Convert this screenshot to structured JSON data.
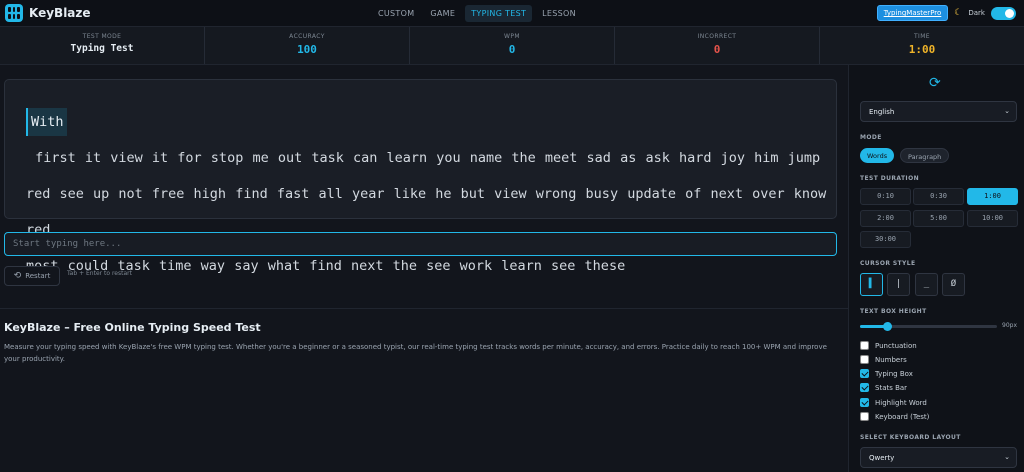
{
  "app": {
    "name": "KeyBlaze"
  },
  "nav": {
    "tabs": [
      {
        "label": "CUSTOM",
        "active": false
      },
      {
        "label": "GAME",
        "active": false
      },
      {
        "label": "TYPING TEST",
        "active": true
      },
      {
        "label": "LESSON",
        "active": false
      }
    ]
  },
  "header_right": {
    "pro_label": "TypingMasterPro",
    "dark_label": "Dark",
    "dark_enabled": true
  },
  "stats": [
    {
      "label": "TEST MODE",
      "value": "Typing Test",
      "color": "#e6edf3"
    },
    {
      "label": "ACCURACY",
      "value": "100",
      "color": "#22b8e8"
    },
    {
      "label": "WPM",
      "value": "0",
      "color": "#22b8e8"
    },
    {
      "label": "INCORRECT",
      "value": "0",
      "color": "#e5534b"
    },
    {
      "label": "TIME",
      "value": "1:00",
      "color": "#f0b429"
    }
  ],
  "typing": {
    "current_word": "With",
    "line1_rest": " first it view it for stop me out task can learn you name the meet sad as ask hard joy him jump",
    "line2": "red see up not free high find fast all year like he but view wrong busy update of next over know red",
    "line3": "most could task time way say what find next the see work learn see these",
    "input_placeholder": "Start typing here...",
    "restart_label": "Restart",
    "hint": "Tab + Enter to restart"
  },
  "info": {
    "title": "KeyBlaze – Free Online Typing Speed Test",
    "description": "Measure your typing speed with KeyBlaze's free WPM typing test. Whether you're a beginner or a seasoned typist, our real-time typing test tracks words per minute, accuracy, and errors. Practice daily to reach 100+ WPM and improve your productivity."
  },
  "sidebar": {
    "language": "English",
    "mode_label": "MODE",
    "modes": [
      {
        "label": "Words",
        "active": true
      },
      {
        "label": "Paragraph",
        "active": false
      }
    ],
    "duration_label": "TEST DURATION",
    "durations": [
      {
        "label": "0:10",
        "active": false
      },
      {
        "label": "0:30",
        "active": false
      },
      {
        "label": "1:00",
        "active": true
      },
      {
        "label": "2:00",
        "active": false
      },
      {
        "label": "5:00",
        "active": false
      },
      {
        "label": "10:00",
        "active": false
      },
      {
        "label": "30:00",
        "active": false
      }
    ],
    "cursor_label": "CURSOR STYLE",
    "cursors": [
      "▌",
      "|",
      "_",
      "Ø"
    ],
    "height_label": "TEXT BOX HEIGHT",
    "height_value": "90px",
    "height_fraction": 0.2,
    "options": [
      {
        "label": "Punctuation",
        "checked": false
      },
      {
        "label": "Numbers",
        "checked": false
      },
      {
        "label": "Typing Box",
        "checked": true
      },
      {
        "label": "Stats Bar",
        "checked": true
      },
      {
        "label": "Highlight Word",
        "checked": true
      },
      {
        "label": "Keyboard (Test)",
        "checked": false
      }
    ],
    "layout_label": "SELECT KEYBOARD LAYOUT",
    "layout": "Qwerty"
  },
  "colors": {
    "accent": "#22b8e8",
    "error": "#e5534b",
    "time": "#f0b429"
  }
}
